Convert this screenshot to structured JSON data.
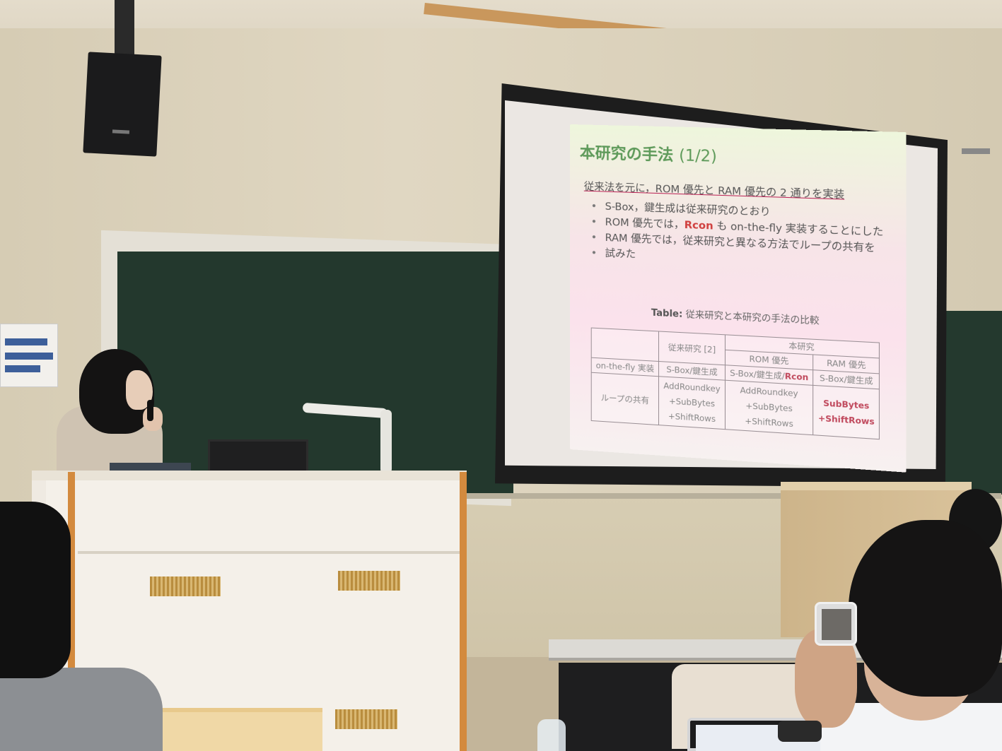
{
  "slide": {
    "title_main": "本研究の手法",
    "title_part": "(1/2)",
    "lead": "従来法を元に，ROM 優先と RAM 優先の 2 通りを実装",
    "bullets": [
      {
        "text": "S-Box，鍵生成は従来研究のとおり"
      },
      {
        "before": "ROM 優先では，",
        "emphasis": "Rcon",
        "after": " も on-the-fly 実装することにした"
      },
      {
        "text": "RAM 優先では，従来研究と異なる方法でループの共有を",
        "continuation": "試みた"
      }
    ],
    "table": {
      "caption_label": "Table:",
      "caption_text": "従来研究と本研究の手法の比較",
      "header_prev": "従来研究 [2]",
      "header_ours": "本研究",
      "sub_rom": "ROM 優先",
      "sub_ram": "RAM 優先",
      "rows": [
        {
          "label": "on-the-fly 実装",
          "prev": "S-Box/鍵生成",
          "rom_prefix": "S-Box/鍵生成/",
          "rom_emphasis": "Rcon",
          "ram": "S-Box/鍵生成"
        },
        {
          "label": "ループの共有",
          "prev": [
            "AddRoundkey",
            "+SubBytes",
            "+ShiftRows"
          ],
          "rom": [
            "AddRoundkey",
            "+SubBytes",
            "+ShiftRows"
          ],
          "ram": [
            "SubBytes",
            "+ShiftRows"
          ]
        }
      ]
    }
  },
  "colors": {
    "title": "#5e9a5a",
    "emphasis": "#d0403f",
    "blackboard": "#23382d",
    "podium_trim": "#d38a3e"
  }
}
